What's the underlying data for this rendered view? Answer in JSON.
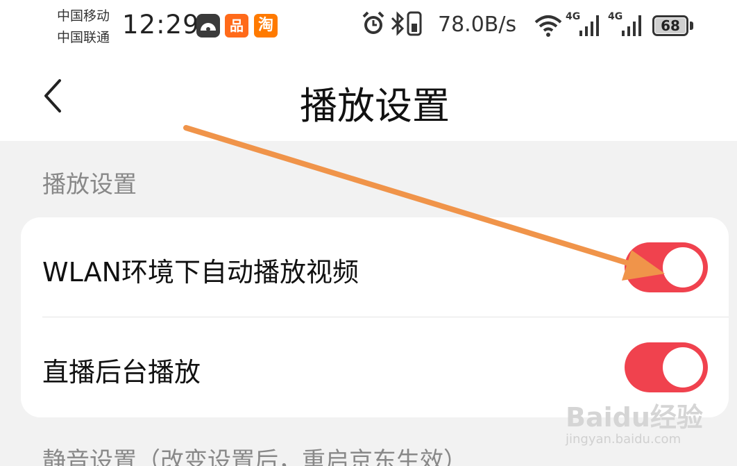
{
  "status_bar": {
    "carrier_1": "中国移动",
    "carrier_2": "中国联通",
    "time": "12:29",
    "app_icons": [
      "dashboard-car-icon",
      "kuaishou-icon",
      "taobao-icon"
    ],
    "kuai_glyph": "品",
    "tao_glyph": "淘",
    "icons": [
      "alarm-icon",
      "bluetooth-icon",
      "phone-vibrate-icon"
    ],
    "net_speed": "78.0B/s",
    "network": [
      "wifi-icon",
      "signal-4g-icon",
      "signal-4g-icon"
    ],
    "network_type_1": "4G",
    "network_type_2": "4G",
    "battery": "68"
  },
  "nav": {
    "back_icon": "chevron-left-icon",
    "title": "播放设置"
  },
  "sections": {
    "playback": {
      "header": "播放设置",
      "items": [
        {
          "label": "WLAN环境下自动播放视频",
          "enabled": true
        },
        {
          "label": "直播后台播放",
          "enabled": true
        }
      ]
    },
    "mute": {
      "header": "静音设置（改变设置后，重启京东生效）"
    }
  },
  "colors": {
    "toggle_on": "#f0424e",
    "annotation_arrow": "#f0944a"
  },
  "watermark": {
    "brand": "Baidu经验",
    "url": "jingyan.baidu.com"
  }
}
